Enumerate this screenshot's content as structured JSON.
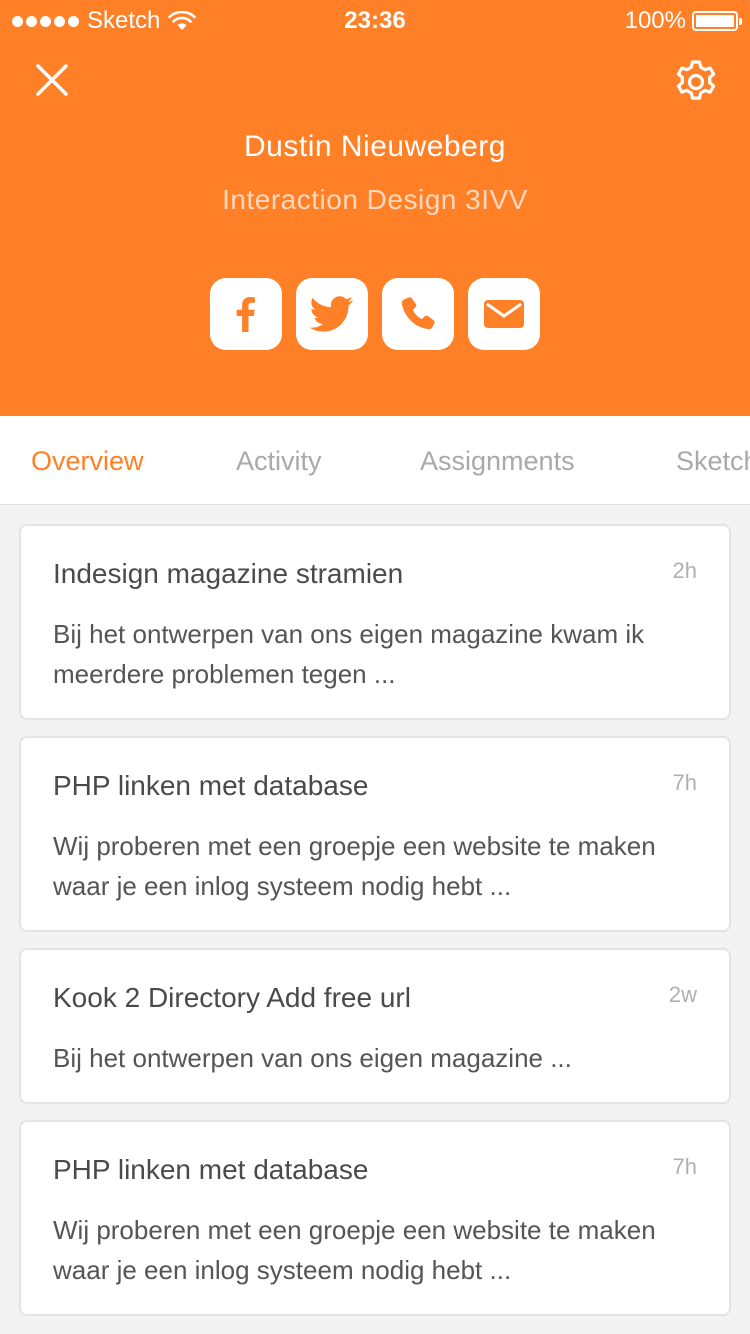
{
  "status_bar": {
    "carrier": "Sketch",
    "time": "23:36",
    "battery": "100%",
    "battery_level": 1.0
  },
  "header": {
    "close_icon": "close-icon",
    "settings_icon": "gear-icon",
    "name": "Dustin Nieuweberg",
    "subtitle": "Interaction Design 3IVV",
    "background_color": "#ff8027",
    "socials": [
      {
        "icon": "facebook-icon"
      },
      {
        "icon": "twitter-icon"
      },
      {
        "icon": "phone-icon"
      },
      {
        "icon": "mail-icon"
      }
    ]
  },
  "tabs": [
    {
      "label": "Overview",
      "active": true
    },
    {
      "label": "Activity",
      "active": false
    },
    {
      "label": "Assignments",
      "active": false
    },
    {
      "label": "Sketches",
      "active": false
    }
  ],
  "cards": [
    {
      "title": "Indesign magazine stramien",
      "time": "2h",
      "body": "Bij het ontwerpen van ons eigen magazine kwam ik meerdere problemen tegen ..."
    },
    {
      "title": "PHP linken met database",
      "time": "7h",
      "body": "Wij proberen met een groepje een website te maken waar je een inlog systeem nodig hebt ..."
    },
    {
      "title": "Kook 2 Directory Add free url",
      "time": "2w",
      "body": "Bij het ontwerpen van ons eigen magazine ..."
    },
    {
      "title": "PHP linken met database",
      "time": "7h",
      "body": "Wij proberen met een groepje een website te maken waar je een inlog systeem nodig hebt ..."
    }
  ]
}
